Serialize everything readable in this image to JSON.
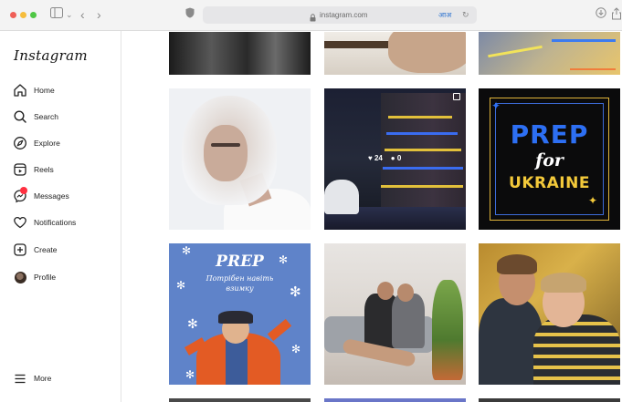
{
  "browser": {
    "url": "instagram.com",
    "translate_label": "आअ"
  },
  "sidebar": {
    "logo": "Instagram",
    "items": [
      {
        "label": "Home"
      },
      {
        "label": "Search"
      },
      {
        "label": "Explore"
      },
      {
        "label": "Reels"
      },
      {
        "label": "Messages"
      },
      {
        "label": "Notifications"
      },
      {
        "label": "Create"
      },
      {
        "label": "Profile"
      }
    ],
    "more_label": "More"
  },
  "posts": [
    {
      "likes": "24",
      "comments": "0"
    },
    {
      "title": "PREP",
      "for": "for",
      "sub": "UKRAINE"
    },
    {
      "title": "PREP",
      "sub_line1": "Потрібен навіть",
      "sub_line2": "взимку"
    }
  ],
  "colors": {
    "accent_blue": "#2d6ff3",
    "ukraine_yellow": "#f3c93a",
    "badge_red": "#ff3040"
  }
}
